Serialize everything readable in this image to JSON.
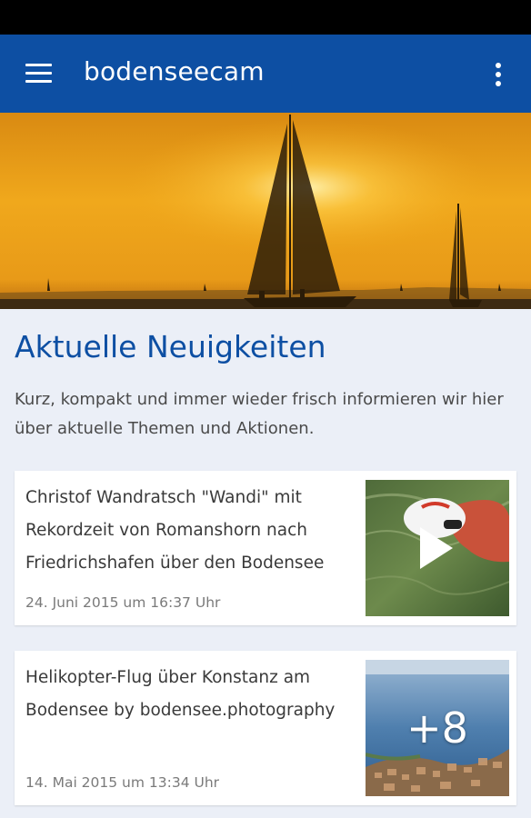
{
  "app_bar": {
    "title": "bodenseecam",
    "menu_icon": "hamburger-menu-icon",
    "overflow_icon": "more-vert-icon",
    "color": "#0d4fa3"
  },
  "hero": {
    "description_icon": "sailboat-sunset-photo"
  },
  "section": {
    "title": "Aktuelle Neuigkeiten",
    "intro": "Kurz, kompakt und immer wieder frisch informieren wir hier über aktuelle Themen und Aktionen."
  },
  "news": [
    {
      "headline": "Christof Wandratsch \"Wandi\" mit Rekordzeit von Romanshorn nach Friedrichshafen über den Bodensee",
      "date": "24. Juni 2015 um 16:37 Uhr",
      "thumb_icon": "play-icon"
    },
    {
      "headline": "Helikopter-Flug über Konstanz am Bodensee by bodensee.photography",
      "date": "14. Mai 2015 um 13:34 Uhr",
      "extra_count": "+8"
    }
  ]
}
